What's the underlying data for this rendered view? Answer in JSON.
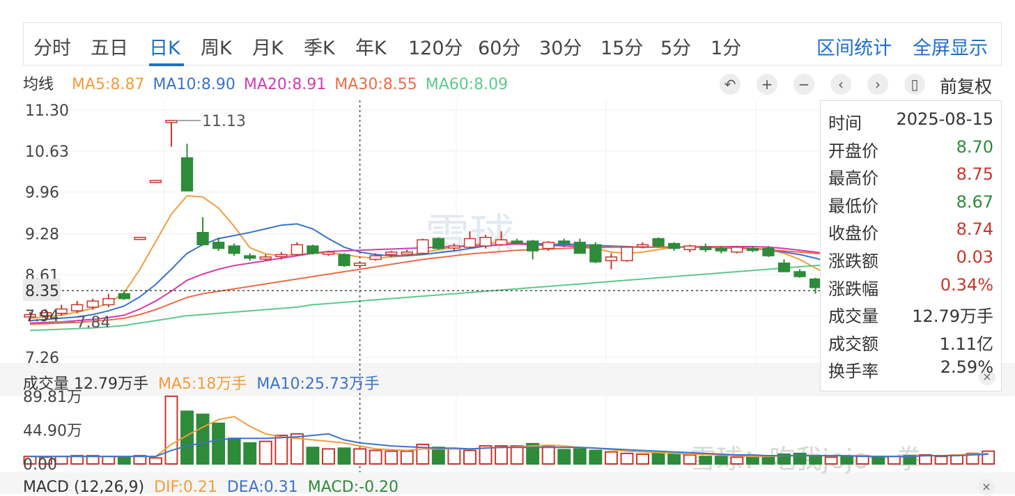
{
  "tabs": {
    "items": [
      "分时",
      "五日",
      "日K",
      "周K",
      "月K",
      "季K",
      "年K",
      "120分",
      "60分",
      "30分",
      "15分",
      "5分",
      "1分"
    ],
    "active_index": 2,
    "right": [
      "区间统计",
      "全屏显示"
    ]
  },
  "ma_legend": {
    "label": "均线",
    "items": [
      {
        "text": "MA5:8.87",
        "color": "#f39c3a"
      },
      {
        "text": "MA10:8.90",
        "color": "#3a73c9"
      },
      {
        "text": "MA20:8.91",
        "color": "#d23bb2"
      },
      {
        "text": "MA30:8.55",
        "color": "#ee6b45"
      },
      {
        "text": "MA60:8.09",
        "color": "#5dc98a"
      }
    ]
  },
  "controls": {
    "icons": [
      "undo-icon",
      "zoom-in-icon",
      "zoom-out-icon",
      "chevron-left-icon",
      "chevron-right-icon",
      "candlestick-icon"
    ],
    "glyphs": [
      "↶",
      "+",
      "−",
      "‹",
      "›",
      "▯"
    ],
    "fuquan": "前复权"
  },
  "info_panel": {
    "rows": [
      {
        "k": "时间",
        "v": "2025-08-15",
        "color": "#333333"
      },
      {
        "k": "开盘价",
        "v": "8.70",
        "color": "#2e8b3a"
      },
      {
        "k": "最高价",
        "v": "8.75",
        "color": "#c8352a"
      },
      {
        "k": "最低价",
        "v": "8.67",
        "color": "#2e8b3a"
      },
      {
        "k": "收盘价",
        "v": "8.74",
        "color": "#c8352a"
      },
      {
        "k": "涨跌额",
        "v": "0.03",
        "color": "#c8352a"
      },
      {
        "k": "涨跌幅",
        "v": "0.34%",
        "color": "#c8352a"
      },
      {
        "k": "成交量",
        "v": "12.79万手",
        "color": "#333333"
      },
      {
        "k": "成交额",
        "v": "1.11亿",
        "color": "#333333"
      },
      {
        "k": "换手率",
        "v": "2.59%",
        "color": "#333333"
      }
    ],
    "close": "×"
  },
  "volume_legend": {
    "items": [
      {
        "text": "成交量 12.79万手",
        "color": "#333333"
      },
      {
        "text": "MA5:18万手",
        "color": "#f39c3a"
      },
      {
        "text": "MA10:25.73万手",
        "color": "#3a73c9"
      }
    ]
  },
  "macd_legend": {
    "items": [
      {
        "text": "MACD (12,26,9)",
        "color": "#333333"
      },
      {
        "text": "DIF:0.21",
        "color": "#f39c3a"
      },
      {
        "text": "DEA:0.31",
        "color": "#3a73c9"
      },
      {
        "text": "MACD:-0.20",
        "color": "#2e8b3a"
      }
    ],
    "close": "×"
  },
  "watermark": {
    "center": "雪球",
    "bottom": "雪球：吃我jojo一拳"
  },
  "chart_data": [
    {
      "type": "candlestick",
      "ylim": [
        7.26,
        11.3
      ],
      "y_ticks": [
        "11.30",
        "10.63",
        "9.96",
        "9.28",
        "8.61",
        "7.94",
        "7.26"
      ],
      "crosshair_label": "8.35",
      "crosshair_y": 8.35,
      "crosshair_index": 21,
      "annotations": [
        {
          "text": "11.13",
          "index": 9,
          "value": 11.13
        },
        {
          "text": "7.84",
          "index": 1,
          "value": 7.84
        }
      ],
      "candles": [
        {
          "o": 7.92,
          "h": 8.0,
          "l": 7.84,
          "c": 7.96
        },
        {
          "o": 7.94,
          "h": 8.05,
          "l": 7.86,
          "c": 7.99
        },
        {
          "o": 7.98,
          "h": 8.12,
          "l": 7.94,
          "c": 8.05
        },
        {
          "o": 8.02,
          "h": 8.18,
          "l": 7.98,
          "c": 8.12
        },
        {
          "o": 8.08,
          "h": 8.22,
          "l": 8.04,
          "c": 8.18
        },
        {
          "o": 8.12,
          "h": 8.3,
          "l": 8.08,
          "c": 8.22
        },
        {
          "o": 8.3,
          "h": 8.36,
          "l": 8.2,
          "c": 8.22
        },
        {
          "o": 9.21,
          "h": 9.22,
          "l": 9.2,
          "c": 9.22
        },
        {
          "o": 10.14,
          "h": 10.15,
          "l": 10.13,
          "c": 10.15
        },
        {
          "o": 11.12,
          "h": 11.13,
          "l": 10.7,
          "c": 11.13
        },
        {
          "o": 10.52,
          "h": 10.75,
          "l": 9.97,
          "c": 9.98
        },
        {
          "o": 9.3,
          "h": 9.55,
          "l": 9.1,
          "c": 9.1
        },
        {
          "o": 9.14,
          "h": 9.22,
          "l": 9.0,
          "c": 9.04
        },
        {
          "o": 9.08,
          "h": 9.12,
          "l": 8.92,
          "c": 8.96
        },
        {
          "o": 8.92,
          "h": 8.96,
          "l": 8.84,
          "c": 8.88
        },
        {
          "o": 8.88,
          "h": 8.94,
          "l": 8.84,
          "c": 8.9
        },
        {
          "o": 8.92,
          "h": 8.98,
          "l": 8.86,
          "c": 8.94
        },
        {
          "o": 8.94,
          "h": 9.14,
          "l": 8.92,
          "c": 9.1
        },
        {
          "o": 9.08,
          "h": 9.1,
          "l": 8.94,
          "c": 8.96
        },
        {
          "o": 8.96,
          "h": 9.0,
          "l": 8.92,
          "c": 8.98
        },
        {
          "o": 8.94,
          "h": 8.96,
          "l": 8.74,
          "c": 8.76
        },
        {
          "o": 8.76,
          "h": 8.82,
          "l": 8.72,
          "c": 8.8
        },
        {
          "o": 8.86,
          "h": 8.96,
          "l": 8.84,
          "c": 8.92
        },
        {
          "o": 8.94,
          "h": 9.0,
          "l": 8.9,
          "c": 8.98
        },
        {
          "o": 8.98,
          "h": 9.02,
          "l": 8.94,
          "c": 8.98
        },
        {
          "o": 8.96,
          "h": 9.2,
          "l": 8.94,
          "c": 9.18
        },
        {
          "o": 9.2,
          "h": 9.22,
          "l": 9.02,
          "c": 9.04
        },
        {
          "o": 9.06,
          "h": 9.12,
          "l": 9.0,
          "c": 9.08
        },
        {
          "o": 9.06,
          "h": 9.32,
          "l": 9.04,
          "c": 9.2
        },
        {
          "o": 9.08,
          "h": 9.26,
          "l": 9.04,
          "c": 9.22
        },
        {
          "o": 9.1,
          "h": 9.32,
          "l": 9.08,
          "c": 9.18
        },
        {
          "o": 9.16,
          "h": 9.2,
          "l": 9.1,
          "c": 9.14
        },
        {
          "o": 9.16,
          "h": 9.18,
          "l": 8.86,
          "c": 9.0
        },
        {
          "o": 9.04,
          "h": 9.16,
          "l": 9.0,
          "c": 9.14
        },
        {
          "o": 9.16,
          "h": 9.2,
          "l": 9.06,
          "c": 9.12
        },
        {
          "o": 9.14,
          "h": 9.2,
          "l": 8.98,
          "c": 8.96
        },
        {
          "o": 9.1,
          "h": 9.14,
          "l": 8.8,
          "c": 8.82
        },
        {
          "o": 8.84,
          "h": 8.96,
          "l": 8.7,
          "c": 8.9
        },
        {
          "o": 8.84,
          "h": 9.08,
          "l": 8.82,
          "c": 9.06
        },
        {
          "o": 9.08,
          "h": 9.14,
          "l": 9.04,
          "c": 9.1
        },
        {
          "o": 9.2,
          "h": 9.22,
          "l": 9.06,
          "c": 9.08
        },
        {
          "o": 9.12,
          "h": 9.14,
          "l": 9.0,
          "c": 9.04
        },
        {
          "o": 9.02,
          "h": 9.1,
          "l": 8.98,
          "c": 9.08
        },
        {
          "o": 9.06,
          "h": 9.12,
          "l": 8.98,
          "c": 9.02
        },
        {
          "o": 9.04,
          "h": 9.08,
          "l": 8.96,
          "c": 9.0
        },
        {
          "o": 8.98,
          "h": 9.08,
          "l": 8.96,
          "c": 9.06
        },
        {
          "o": 9.04,
          "h": 9.08,
          "l": 8.98,
          "c": 9.02
        },
        {
          "o": 9.04,
          "h": 9.08,
          "l": 8.9,
          "c": 8.92
        },
        {
          "o": 8.8,
          "h": 8.86,
          "l": 8.72,
          "c": 8.66
        },
        {
          "o": 8.66,
          "h": 8.7,
          "l": 8.56,
          "c": 8.58
        },
        {
          "o": 8.54,
          "h": 8.56,
          "l": 8.3,
          "c": 8.4
        },
        {
          "o": 8.44,
          "h": 8.5,
          "l": 8.4,
          "c": 8.48
        },
        {
          "o": 8.48,
          "h": 8.54,
          "l": 8.4,
          "c": 8.42
        },
        {
          "o": 8.4,
          "h": 8.46,
          "l": 8.36,
          "c": 8.44
        },
        {
          "o": 8.46,
          "h": 8.52,
          "l": 8.34,
          "c": 8.42
        },
        {
          "o": 8.44,
          "h": 8.5,
          "l": 8.4,
          "c": 8.46
        },
        {
          "o": 8.6,
          "h": 8.62,
          "l": 8.5,
          "c": 8.52
        },
        {
          "o": 8.54,
          "h": 8.62,
          "l": 8.52,
          "c": 8.6
        },
        {
          "o": 8.28,
          "h": 8.52,
          "l": 8.24,
          "c": 8.5
        },
        {
          "o": 8.5,
          "h": 8.62,
          "l": 8.46,
          "c": 8.56
        },
        {
          "o": 8.56,
          "h": 8.68,
          "l": 8.5,
          "c": 8.64
        },
        {
          "o": 8.64,
          "h": 8.74,
          "l": 8.6,
          "c": 8.68
        }
      ],
      "ma": {
        "MA5": [
          7.9,
          7.92,
          7.95,
          8.0,
          8.06,
          8.14,
          8.32,
          8.7,
          9.15,
          9.6,
          9.9,
          9.88,
          9.7,
          9.4,
          9.05,
          8.95,
          8.92,
          8.94,
          8.96,
          8.97,
          8.94,
          8.9,
          8.88,
          8.9,
          8.92,
          8.97,
          9.02,
          9.06,
          9.1,
          9.12,
          9.14,
          9.13,
          9.1,
          9.1,
          9.12,
          9.1,
          9.04,
          8.98,
          8.96,
          8.98,
          9.02,
          9.06,
          9.07,
          9.06,
          9.05,
          9.04,
          9.03,
          9.02,
          8.96,
          8.86,
          8.72,
          8.58,
          8.48,
          8.44,
          8.44,
          8.44,
          8.48,
          8.5,
          8.5,
          8.52,
          8.56,
          8.6
        ],
        "MA10": [
          7.86,
          7.88,
          7.9,
          7.92,
          7.96,
          8.02,
          8.1,
          8.25,
          8.45,
          8.7,
          8.96,
          9.1,
          9.2,
          9.25,
          9.3,
          9.36,
          9.42,
          9.44,
          9.36,
          9.2,
          9.06,
          8.98,
          8.94,
          8.92,
          8.92,
          8.94,
          8.97,
          9.0,
          9.04,
          9.08,
          9.1,
          9.12,
          9.12,
          9.11,
          9.1,
          9.1,
          9.09,
          9.08,
          9.07,
          9.06,
          9.06,
          9.06,
          9.06,
          9.06,
          9.05,
          9.05,
          9.04,
          9.02,
          8.98,
          8.94,
          8.88,
          8.8,
          8.74,
          8.68,
          8.62,
          8.58,
          8.56,
          8.56,
          8.56,
          8.56,
          8.57,
          8.6
        ],
        "MA20": [
          7.82,
          7.83,
          7.84,
          7.86,
          7.88,
          7.91,
          7.95,
          8.05,
          8.18,
          8.34,
          8.52,
          8.62,
          8.7,
          8.76,
          8.8,
          8.84,
          8.88,
          8.92,
          8.96,
          8.99,
          9.0,
          9.01,
          9.02,
          9.03,
          9.04,
          9.05,
          9.06,
          9.07,
          9.08,
          9.09,
          9.1,
          9.11,
          9.1,
          9.09,
          9.08,
          9.07,
          9.06,
          9.06,
          9.06,
          9.06,
          9.06,
          9.06,
          9.07,
          9.07,
          9.07,
          9.07,
          9.07,
          9.06,
          9.04,
          9.01,
          8.98,
          8.94,
          8.9,
          8.86,
          8.82,
          8.79,
          8.77,
          8.75,
          8.74,
          8.73,
          8.72,
          8.72
        ],
        "MA30": [
          7.8,
          7.81,
          7.82,
          7.83,
          7.85,
          7.87,
          7.9,
          7.96,
          8.04,
          8.14,
          8.24,
          8.3,
          8.34,
          8.38,
          8.42,
          8.46,
          8.5,
          8.54,
          8.58,
          8.62,
          8.66,
          8.7,
          8.74,
          8.78,
          8.82,
          8.86,
          8.89,
          8.92,
          8.95,
          8.97,
          8.99,
          9.01,
          9.02,
          9.03,
          9.04,
          9.05,
          9.05,
          9.06,
          9.06,
          9.06,
          9.06,
          9.06,
          9.06,
          9.06,
          9.06,
          9.05,
          9.04,
          9.02,
          9.0,
          8.98,
          8.96,
          8.94,
          8.92,
          8.9,
          8.89,
          8.88,
          8.87,
          8.86,
          8.85,
          8.84,
          8.84,
          8.83
        ],
        "MA60": [
          7.7,
          7.71,
          7.72,
          7.73,
          7.74,
          7.76,
          7.78,
          7.82,
          7.86,
          7.9,
          7.94,
          7.96,
          7.98,
          8.0,
          8.02,
          8.04,
          8.06,
          8.08,
          8.12,
          8.14,
          8.16,
          8.18,
          8.2,
          8.22,
          8.24,
          8.26,
          8.28,
          8.3,
          8.32,
          8.34,
          8.36,
          8.38,
          8.4,
          8.42,
          8.44,
          8.46,
          8.48,
          8.5,
          8.52,
          8.54,
          8.56,
          8.58,
          8.6,
          8.62,
          8.64,
          8.66,
          8.68,
          8.7,
          8.72,
          8.74,
          8.76,
          8.78,
          8.8,
          8.82,
          8.84,
          8.86,
          8.88,
          8.9,
          8.92,
          8.94,
          8.96,
          8.98
        ]
      }
    },
    {
      "type": "bar",
      "title": "成交量",
      "unit": "万手",
      "ylim": [
        0,
        89.81
      ],
      "y_ticks": [
        "89.81万",
        "44.90万",
        "0.00"
      ],
      "values": [
        10,
        9,
        10,
        11,
        11,
        10,
        9,
        11,
        8,
        90,
        70,
        66,
        54,
        34,
        28,
        30,
        38,
        40,
        22,
        20,
        21,
        20,
        18,
        17,
        17,
        26,
        22,
        20,
        18,
        24,
        24,
        24,
        27,
        24,
        19,
        20,
        18,
        16,
        14,
        13,
        14,
        14,
        12,
        10,
        10,
        9,
        10,
        11,
        13,
        14,
        11,
        9,
        10,
        11,
        10,
        10,
        11,
        12,
        10,
        12,
        14,
        17
      ],
      "ma5": [
        10,
        10,
        10,
        10,
        10,
        10,
        10,
        10,
        10,
        26,
        38,
        49,
        59,
        63,
        50,
        40,
        36,
        34,
        32,
        30,
        28,
        24,
        20,
        19,
        18,
        20,
        20,
        20,
        20,
        21,
        22,
        23,
        24,
        25,
        24,
        22,
        21,
        19,
        17,
        16,
        15,
        14,
        13,
        13,
        12,
        11,
        10,
        10,
        11,
        11,
        11,
        11,
        11,
        11,
        10,
        10,
        10,
        11,
        11,
        12,
        13,
        14
      ],
      "ma10": [
        10,
        10,
        10,
        10,
        10,
        10,
        10,
        10,
        10,
        18,
        24,
        28,
        32,
        34,
        34,
        34,
        35,
        36,
        38,
        40,
        32,
        28,
        26,
        24,
        23,
        22,
        21,
        21,
        20,
        21,
        22,
        22,
        22,
        22,
        22,
        22,
        21,
        20,
        19,
        18,
        17,
        16,
        15,
        14,
        13,
        12,
        12,
        11,
        11,
        11,
        11,
        11,
        11,
        10,
        10,
        10,
        10,
        11,
        11,
        11,
        12,
        13
      ],
      "up": [
        true,
        true,
        true,
        true,
        true,
        true,
        false,
        true,
        true,
        true,
        false,
        false,
        false,
        false,
        false,
        true,
        true,
        true,
        false,
        true,
        false,
        true,
        true,
        true,
        true,
        true,
        false,
        true,
        true,
        true,
        true,
        true,
        false,
        true,
        false,
        false,
        false,
        true,
        true,
        true,
        false,
        false,
        true,
        false,
        false,
        true,
        false,
        false,
        false,
        false,
        false,
        true,
        false,
        true,
        false,
        true,
        false,
        true,
        true,
        true,
        true,
        true
      ]
    }
  ]
}
